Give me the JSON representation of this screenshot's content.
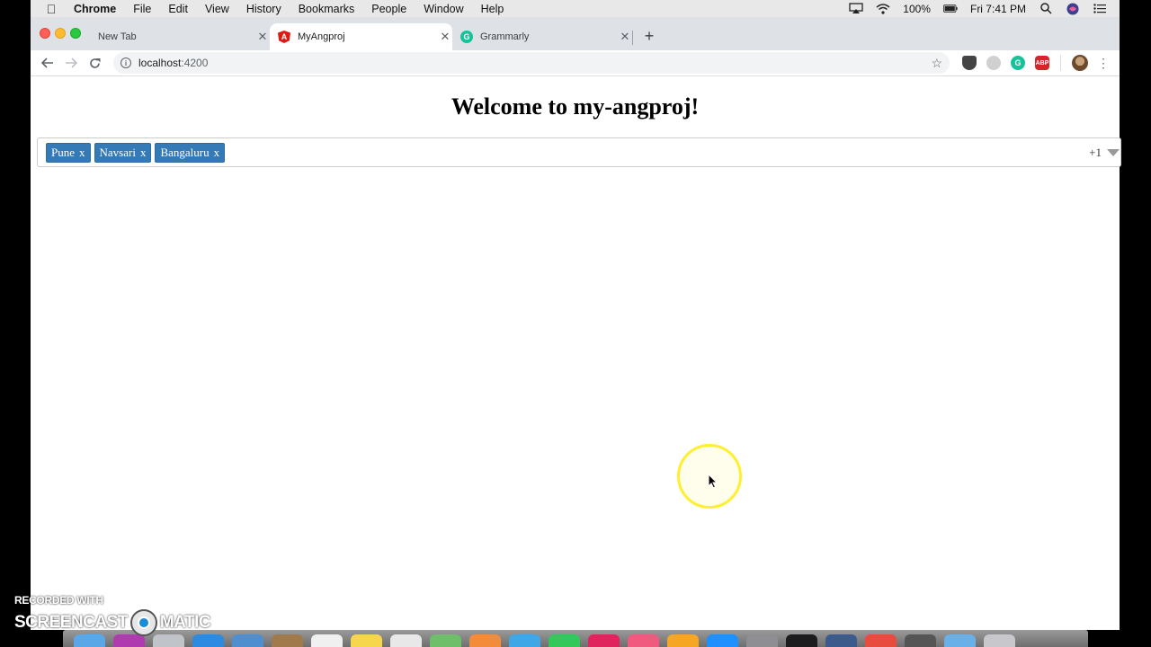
{
  "menubar": {
    "app_name": "Chrome",
    "items": [
      "File",
      "Edit",
      "View",
      "History",
      "Bookmarks",
      "People",
      "Window",
      "Help"
    ],
    "battery": "100%",
    "clock": "Fri 7:41 PM"
  },
  "tabs": [
    {
      "title": "New Tab"
    },
    {
      "title": "MyAngproj"
    },
    {
      "title": "Grammarly"
    }
  ],
  "address_bar": {
    "host": "localhost",
    "port": ":4200"
  },
  "page": {
    "title": "Welcome to my-angproj!",
    "chips": [
      {
        "label": "Pune",
        "remove": "x"
      },
      {
        "label": "Navsari",
        "remove": "x"
      },
      {
        "label": "Bangaluru",
        "remove": "x"
      }
    ],
    "more_count": "+1"
  },
  "watermark": {
    "top": "RECORDED WITH",
    "left": "SCREENCAST",
    "right": "MATIC"
  },
  "colors": {
    "chip_bg": "#337ab7",
    "cursor_ring": "#ffef2e"
  }
}
